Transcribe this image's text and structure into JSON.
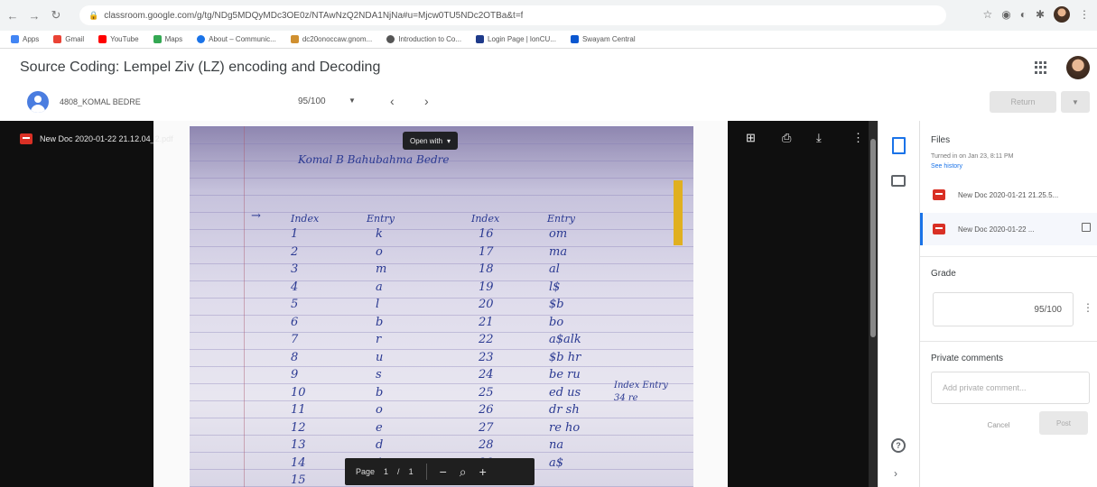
{
  "browser": {
    "url": "classroom.google.com/g/tg/NDg5MDQyMDc3OE0z/NTAwNzQ2NDA1NjNa#u=Mjcw0TU5NDc2OTBa&t=f",
    "bookmarks": [
      "Apps",
      "Gmail",
      "YouTube",
      "Maps",
      "About – Communic...",
      "dc20onoccaw.gnom...",
      "Introduction to Co...",
      "Login Page | lonCU...",
      "Swayam Central"
    ]
  },
  "header": {
    "title": "Source Coding: Lempel Ziv (LZ) encoding and Decoding"
  },
  "student_bar": {
    "name": "4808_KOMAL BEDRE",
    "grade": "95/100",
    "return_label": "Return"
  },
  "viewer": {
    "file_name": "New Doc 2020-01-22 21.12.04_2.pdf",
    "open_with": "Open with",
    "page_label": "Page",
    "page_current": "1",
    "page_sep": "/",
    "page_total": "1",
    "handwriting": {
      "heading": "Komal B Bahubahma Bedre",
      "col_headers": [
        "Index",
        "Entry",
        "Index",
        "Entry"
      ],
      "left_index": [
        "1",
        "2",
        "3",
        "4",
        "5",
        "6",
        "7",
        "8",
        "9",
        "10",
        "11",
        "12",
        "13",
        "14",
        "15"
      ],
      "left_entry": [
        "k",
        "o",
        "m",
        "a",
        "l",
        "b",
        "r",
        "u",
        "s",
        "b",
        "o",
        "e",
        "d",
        "$",
        "$"
      ],
      "right_index": [
        "16",
        "17",
        "18",
        "19",
        "20",
        "21",
        "22",
        "23",
        "24",
        "25",
        "26",
        "27",
        "28",
        "29"
      ],
      "right_entry": [
        "om",
        "ma",
        "al",
        "l$",
        "$b",
        "bo",
        "a$alk",
        "$b hr",
        "be ru",
        "ed us",
        "dr sh",
        "re ho",
        "na",
        "a$"
      ],
      "side_note": [
        "Index Entry",
        "34 re"
      ]
    }
  },
  "sidebar": {
    "files_title": "Files",
    "turned_in": "Turned in on Jan 23, 8:11 PM",
    "see_history": "See history",
    "files": [
      "New Doc 2020-01-21 21.25.5...",
      "New Doc 2020-01-22 ..."
    ],
    "grade_title": "Grade",
    "grade_value": "95/100",
    "comments_title": "Private comments",
    "comment_placeholder": "Add private comment...",
    "cancel_label": "Cancel",
    "post_label": "Post"
  },
  "colors": {
    "accent": "#1a73e8",
    "pdf_red": "#d93025",
    "viewer_bg": "#0f0f0f"
  }
}
